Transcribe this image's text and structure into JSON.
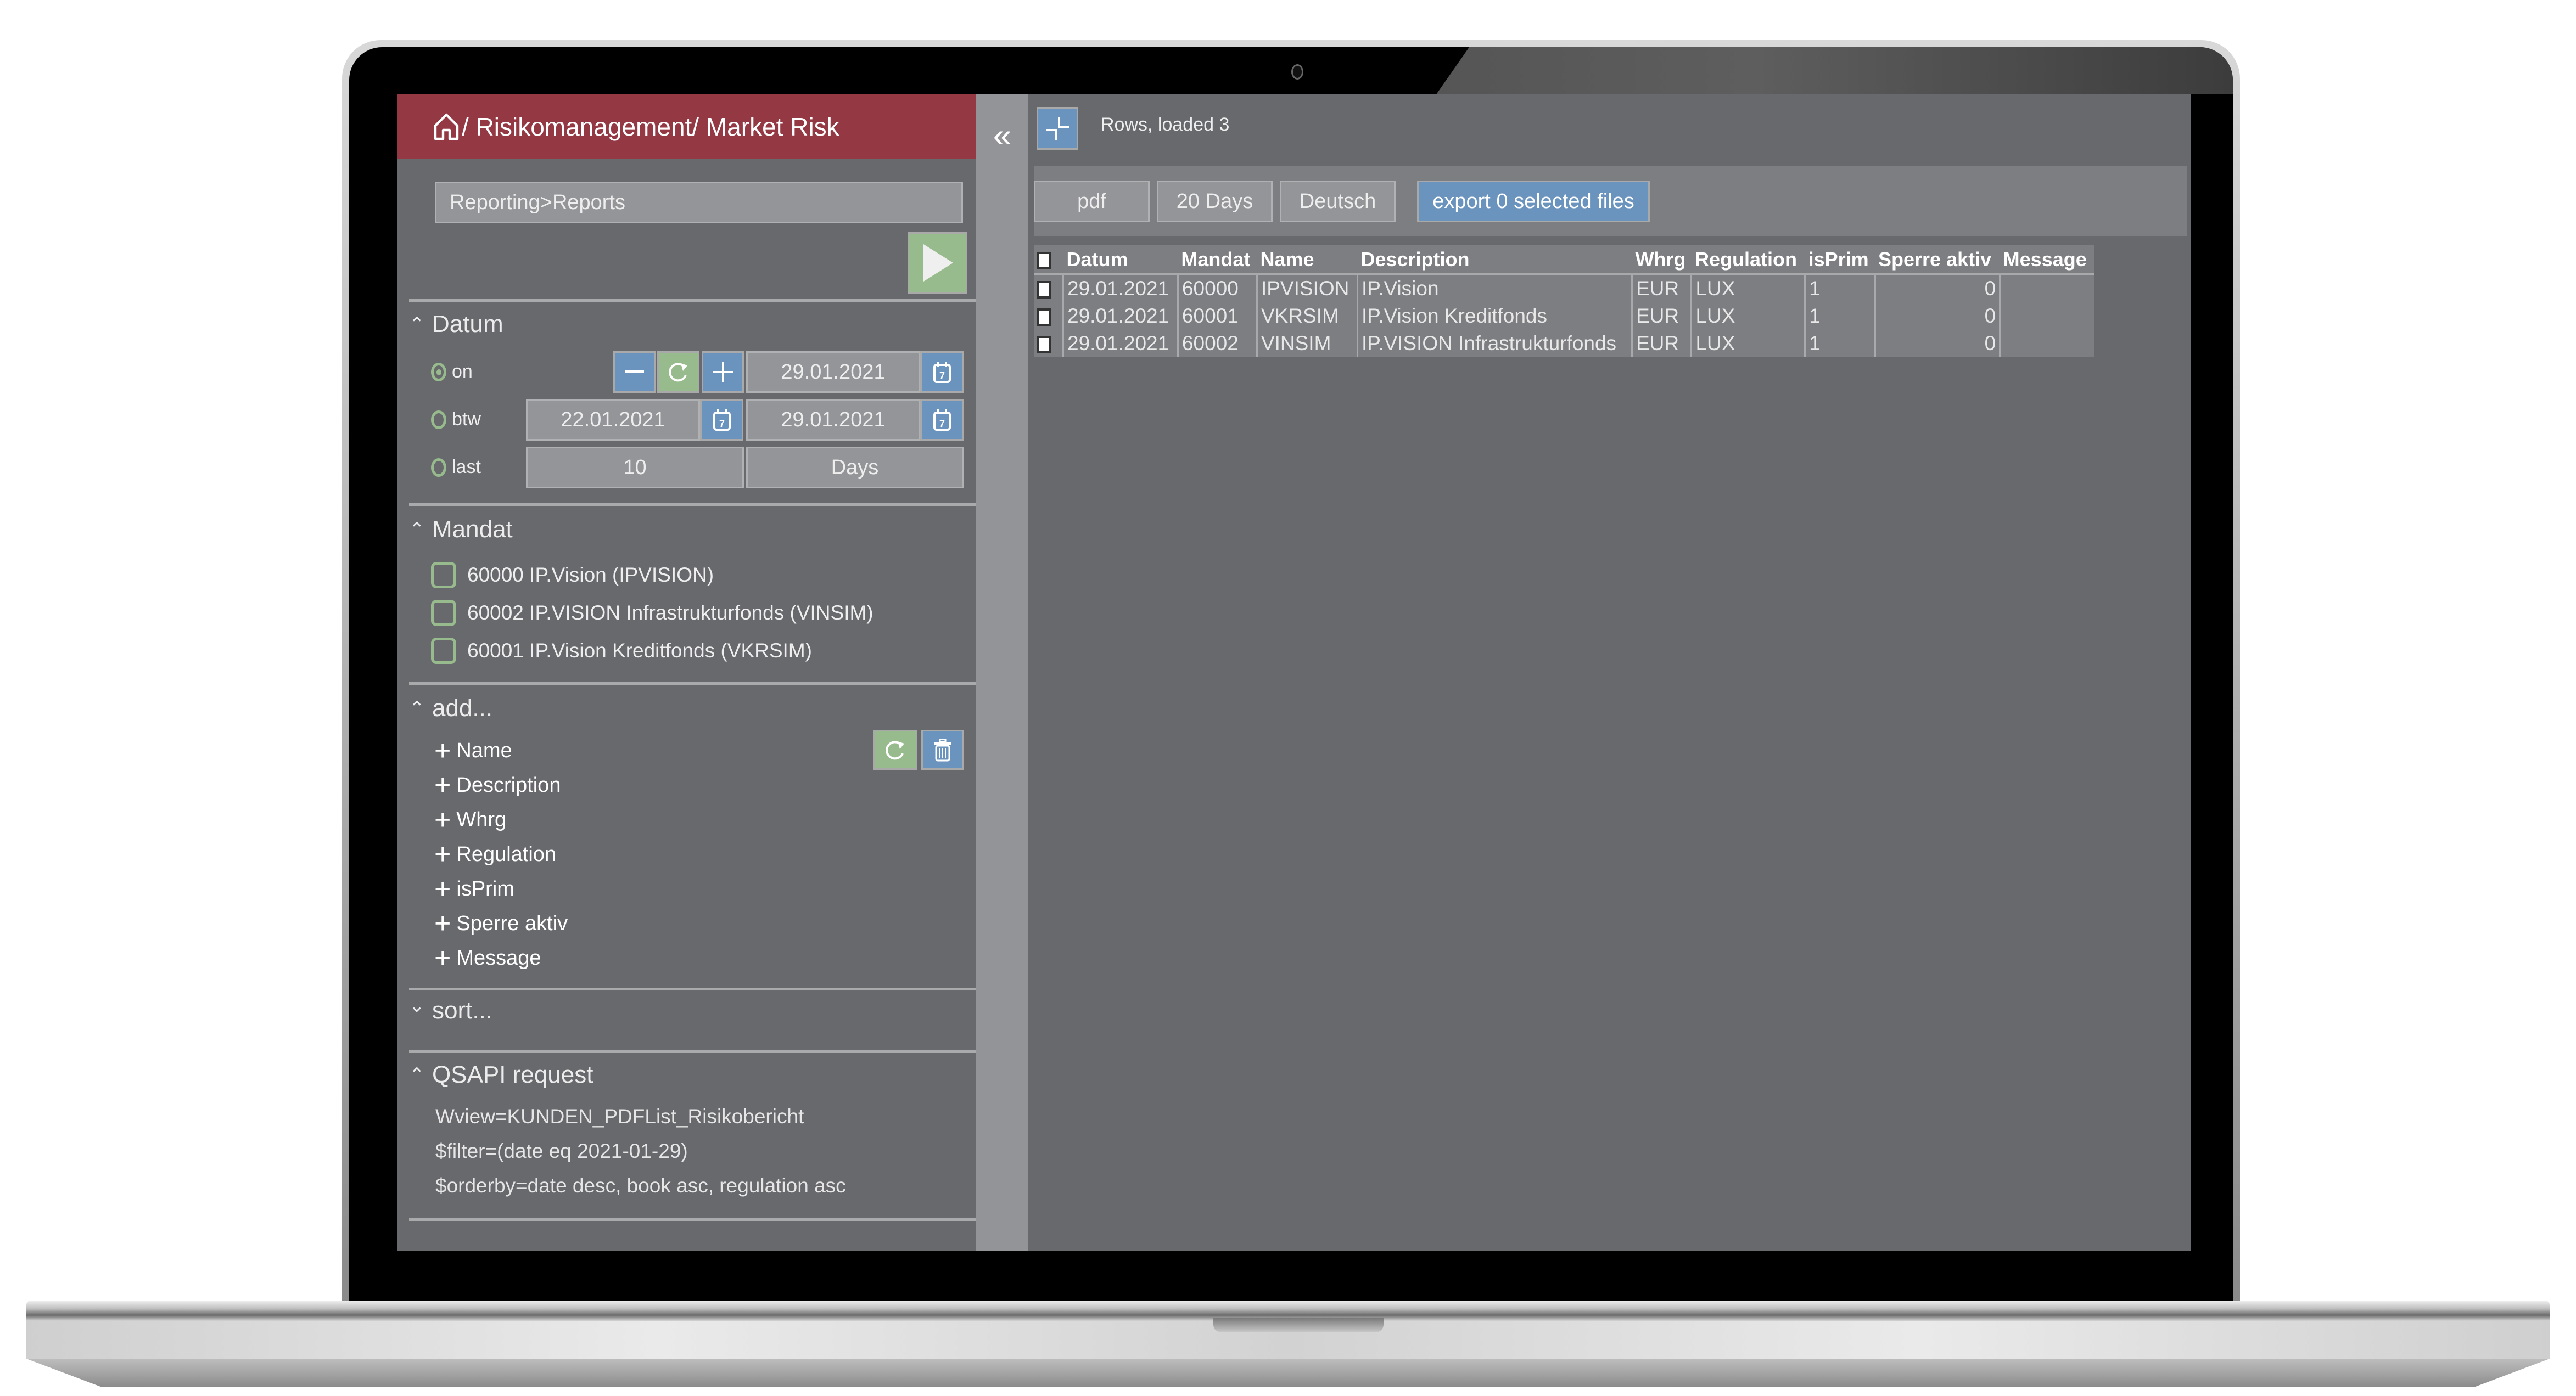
{
  "header": {
    "title": "/ Risikomanagement/ Market Risk",
    "home_icon": "home-icon"
  },
  "path_field": {
    "value": "Reporting>Reports"
  },
  "run_button": {
    "icon": "play-icon",
    "color": "#98bb8d"
  },
  "datum": {
    "title": "Datum",
    "options": [
      {
        "label": "on",
        "selected": true
      },
      {
        "label": "btw",
        "selected": false
      },
      {
        "label": "last",
        "selected": false
      }
    ],
    "on_date": "29.01.2021",
    "btw_from": "22.01.2021",
    "btw_to": "29.01.2021",
    "last_count": "10",
    "last_unit": "Days",
    "minus_icon": "minus-icon",
    "reset_icon": "refresh-icon",
    "plus_icon": "plus-icon",
    "calendar_icon": "calendar-icon",
    "calendar_day": "7"
  },
  "mandat": {
    "title": "Mandat",
    "items": [
      {
        "label": "60000 IP.Vision (IPVISION)",
        "checked": false
      },
      {
        "label": "60002 IP.VISION Infrastrukturfonds (VINSIM)",
        "checked": false
      },
      {
        "label": "60001 IP.Vision Kreditfonds (VKRSIM)",
        "checked": false
      }
    ]
  },
  "add": {
    "title": "add...",
    "items": [
      "Name",
      "Description",
      "Whrg",
      "Regulation",
      "isPrim",
      "Sperre aktiv",
      "Message"
    ],
    "plus_glyph": "+"
  },
  "sort": {
    "title": "sort..."
  },
  "qsapi": {
    "title": "QSAPI request",
    "lines": [
      "Wview=KUNDEN_PDFList_Risikobericht",
      "$filter=(date eq 2021-01-29)",
      "$orderby=date desc, book asc, regulation asc"
    ]
  },
  "collapse": {
    "glyph": "«"
  },
  "main": {
    "rows_info": "Rows, loaded 3",
    "toolbar": {
      "format": "pdf",
      "range": "20 Days",
      "language": "Deutsch",
      "export": "export 0 selected files"
    },
    "table": {
      "columns": [
        "Datum",
        "Mandat",
        "Name",
        "Description",
        "Whrg",
        "Regulation",
        "isPrim",
        "Sperre aktiv",
        "Message"
      ],
      "rows": [
        {
          "datum": "29.01.2021",
          "mandat": "60000",
          "name": "IPVISION",
          "description": "IP.Vision",
          "whrg": "EUR",
          "regulation": "LUX",
          "isprim": "1",
          "sperre": "0",
          "message": ""
        },
        {
          "datum": "29.01.2021",
          "mandat": "60001",
          "name": "VKRSIM",
          "description": "IP.Vision Kreditfonds",
          "whrg": "EUR",
          "regulation": "LUX",
          "isprim": "1",
          "sperre": "0",
          "message": ""
        },
        {
          "datum": "29.01.2021",
          "mandat": "60002",
          "name": "VINSIM",
          "description": "IP.VISION Infrastrukturfonds",
          "whrg": "EUR",
          "regulation": "LUX",
          "isprim": "1",
          "sperre": "0",
          "message": ""
        }
      ]
    }
  },
  "colors": {
    "header_red": "#943843",
    "accent_blue": "#6a93bd",
    "accent_green": "#98bb8d",
    "panel_bg": "#68696d"
  }
}
